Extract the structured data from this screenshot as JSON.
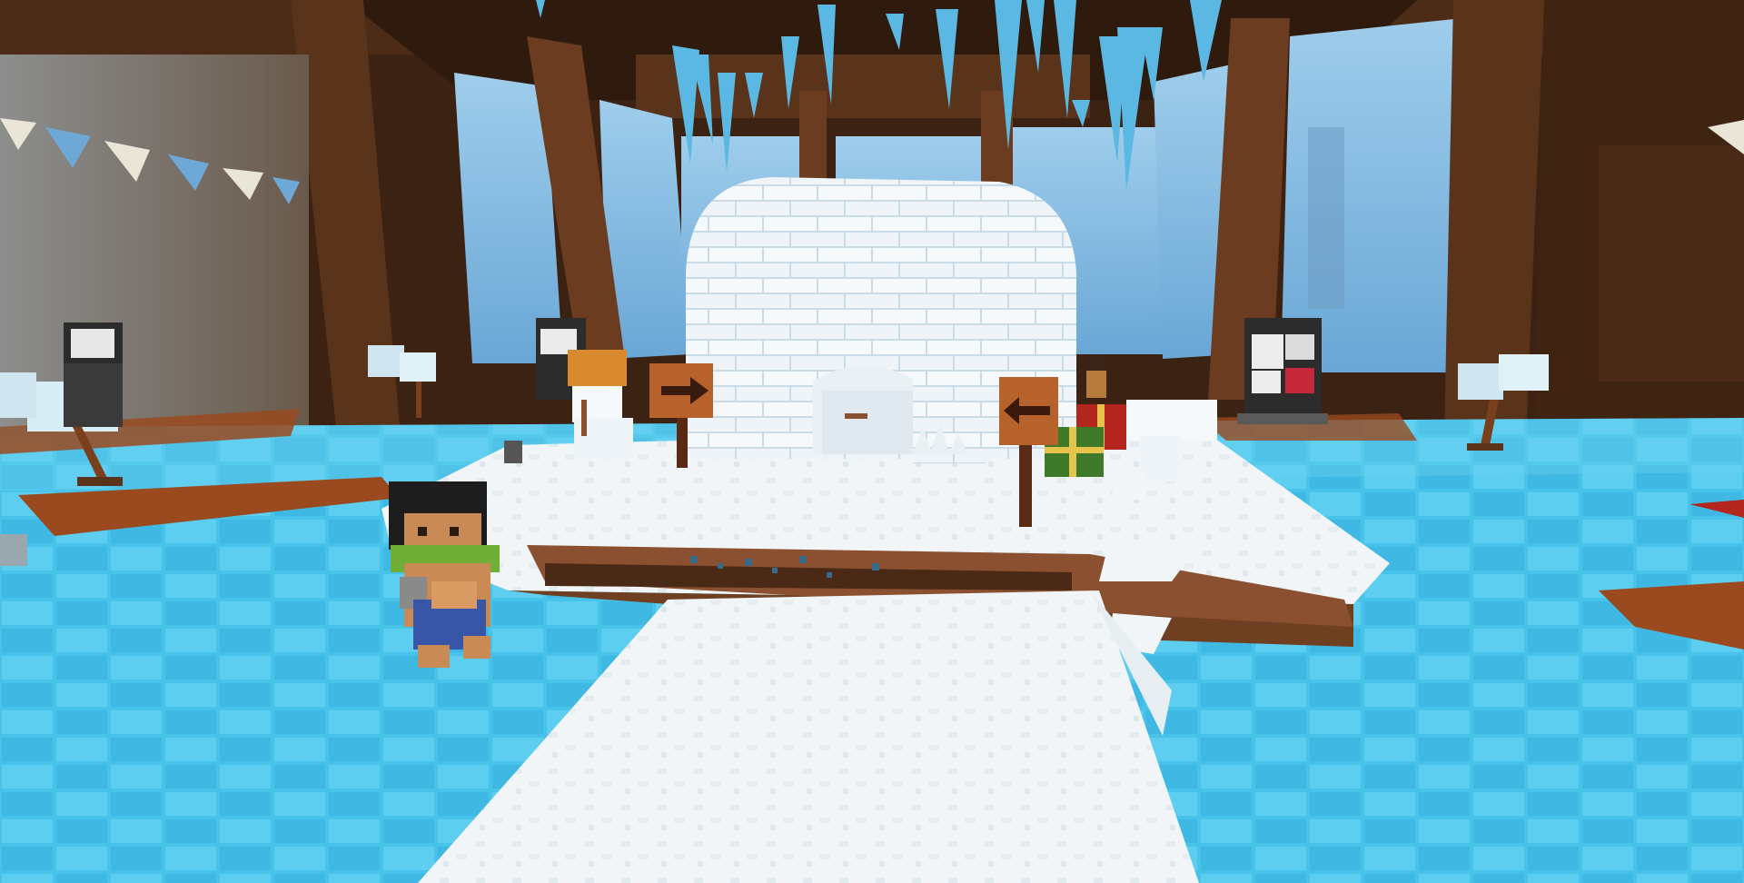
{
  "scene": {
    "description_free": true,
    "hud": {},
    "palette": {
      "wood_dark": "#4a2a16",
      "wood": "#6e3f20",
      "wood_light": "#8b5030",
      "window_sky": "#8ec3e6",
      "window_sky_deep": "#5f9ccf",
      "ice_floor": "#47c3ea",
      "ice_floor_light": "#8fdcf5",
      "ice_grout": "#2a9fd0",
      "snow": "#f3f6f8",
      "snow_shadow": "#cfdbe2",
      "igloo_block": "#f5f9fb",
      "igloo_mortar": "#c9dbe6",
      "icicle": "#5ab8e2",
      "rug": "#9a4a1e",
      "banner_white": "#e9e6d8",
      "banner_blue": "#6ea8d6",
      "gift_red": "#b3261e",
      "gift_green": "#3f7a2a",
      "gift_ribbon": "#e6c34a",
      "pumpkin": "#d98a2e",
      "player_hair": "#1d1d1d",
      "player_skin": "#c98a55",
      "player_scarf": "#6fae37",
      "player_pants": "#3856a8",
      "sign_board": "#b6622a"
    }
  }
}
